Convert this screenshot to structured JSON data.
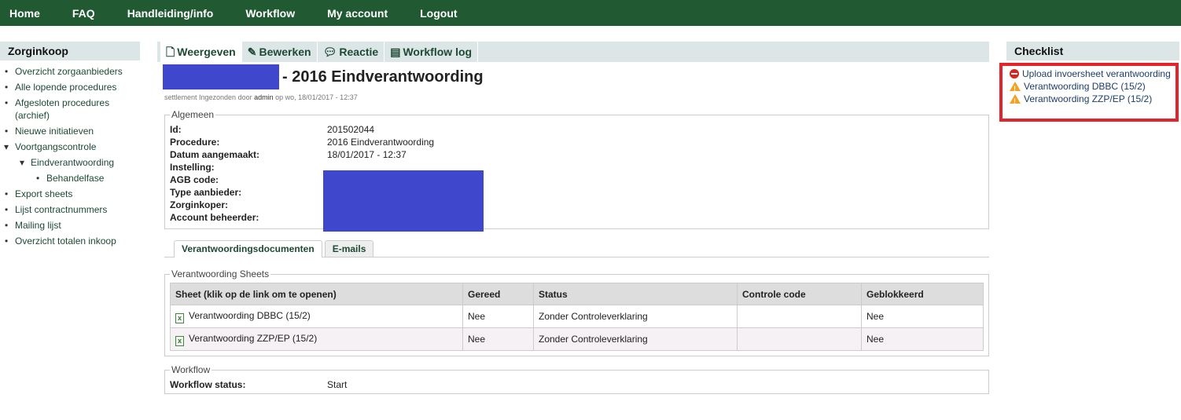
{
  "nav": [
    "Home",
    "FAQ",
    "Handleiding/info",
    "Workflow",
    "My account",
    "Logout"
  ],
  "sidebar": {
    "title": "Zorginkoop",
    "items": [
      {
        "label": "Overzicht zorgaanbieders",
        "level": 1
      },
      {
        "label": "Alle lopende procedures",
        "level": 1
      },
      {
        "label": "Afgesloten procedures (archief)",
        "level": 1
      },
      {
        "label": "Nieuwe initiatieven",
        "level": 1
      },
      {
        "label": "Voortgangscontrole",
        "level": 1,
        "expanded": true
      },
      {
        "label": "Eindverantwoording",
        "level": 2,
        "expanded": true
      },
      {
        "label": "Behandelfase",
        "level": 3
      },
      {
        "label": "Export sheets",
        "level": 1
      },
      {
        "label": "Lijst contractnummers",
        "level": 1
      },
      {
        "label": "Mailing lijst",
        "level": 1
      },
      {
        "label": "Overzicht totalen inkoop",
        "level": 1
      }
    ]
  },
  "tabs": [
    {
      "label": "Weergeven",
      "icon": "document-icon"
    },
    {
      "label": "Bewerken",
      "icon": "pencil-icon"
    },
    {
      "label": "Reactie",
      "icon": "speech-bubble-icon"
    },
    {
      "label": "Workflow log",
      "icon": "list-icon"
    }
  ],
  "page": {
    "title": "- 2016 Eindverantwoording",
    "meta_pre": "settlement Ingezonden door",
    "meta_user": "admin",
    "meta_post": "op wo, 18/01/2017 - 12:37"
  },
  "algemeen": {
    "legend": "Algemeen",
    "rows": [
      {
        "k": "Id:",
        "v": "201502044"
      },
      {
        "k": "Procedure:",
        "v": "2016 Eindverantwoording"
      },
      {
        "k": "Datum aangemaakt:",
        "v": "18/01/2017 - 12:37"
      },
      {
        "k": "Instelling:",
        "v": ""
      },
      {
        "k": "AGB code:",
        "v": ""
      },
      {
        "k": "Type aanbieder:",
        "v": ""
      },
      {
        "k": "Zorginkoper:",
        "v": ""
      },
      {
        "k": "Account beheerder:",
        "v": ""
      }
    ]
  },
  "subtabs": [
    "Verantwoordingsdocumenten",
    "E-mails"
  ],
  "sheets": {
    "legend": "Verantwoording Sheets",
    "headers": [
      "Sheet (klik op de link om te openen)",
      "Gereed",
      "Status",
      "Controle code",
      "Geblokkeerd"
    ],
    "rows": [
      [
        "Verantwoording DBBC (15/2)",
        "Nee",
        "Zonder Controleverklaring",
        "",
        "Nee"
      ],
      [
        "Verantwoording ZZP/EP (15/2)",
        "Nee",
        "Zonder Controleverklaring",
        "",
        "Nee"
      ]
    ]
  },
  "workflow": {
    "legend": "Workflow",
    "label": "Workflow status:",
    "value": "Start"
  },
  "checklist": {
    "title": "Checklist",
    "items": [
      {
        "label": "Upload invoersheet verantwoording",
        "icon": "stop"
      },
      {
        "label": "Verantwoording DBBC (15/2)",
        "icon": "warning"
      },
      {
        "label": "Verantwoording ZZP/EP (15/2)",
        "icon": "warning"
      }
    ]
  },
  "colors": {
    "nav": "#215a32",
    "highlight": "#e5232b",
    "redaction": "#3f47cc"
  }
}
